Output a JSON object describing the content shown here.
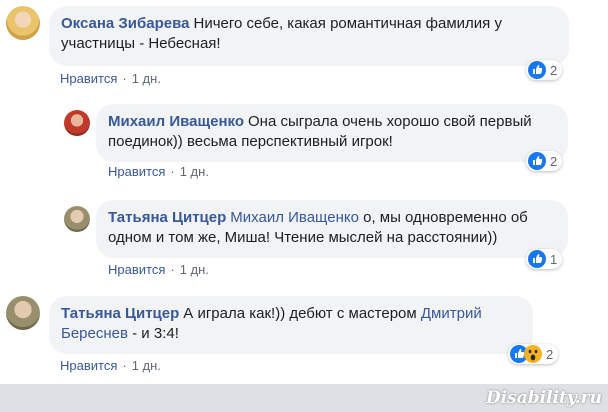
{
  "comments": [
    {
      "author": "Оксана Зибарева",
      "text": "Ничего себе, какая романтичная фамилия у участницы - Небесная!",
      "like_label": "Нравится",
      "time": "1 дн.",
      "reaction_count": "2",
      "reaction_icon": "like-icon"
    },
    {
      "author": "Михаил Иващенко",
      "text": "Она сыграла очень хорошо свой первый поединок)) весьма перспективный игрок!",
      "like_label": "Нравится",
      "time": "1 дн.",
      "reaction_count": "2",
      "reaction_icon": "like-icon"
    },
    {
      "author": "Татьяна Цитцер",
      "mention": "Михаил Иващенко",
      "text": "о, мы одновременно об одном и том же, Миша! Чтение мыслей на расстоянии))",
      "like_label": "Нравится",
      "time": "1 дн.",
      "reaction_count": "1",
      "reaction_icon": "like-icon"
    },
    {
      "author": "Татьяна Цитцер",
      "text_before": "А играла как!)) дебют с мастером",
      "mention": "Дмитрий Береснев",
      "text_after": "- и 3:4!",
      "like_label": "Нравится",
      "time": "1 дн.",
      "reaction_count": "2",
      "reaction_icon": "like-wow-icons"
    }
  ],
  "watermark": "Disability.ru",
  "colors": {
    "link": "#385898",
    "bubble": "#f2f3f5",
    "meta": "#606770",
    "like_blue": "#1877f2",
    "wow_yellow": "#f7b125"
  }
}
